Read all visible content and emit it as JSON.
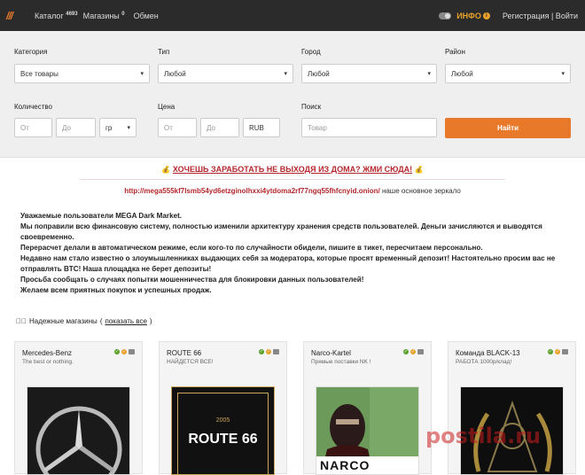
{
  "topbar": {
    "logo": "///",
    "catalog_label": "Каталог",
    "catalog_count": "4693",
    "shops_label": "Магазины",
    "shops_count": "0",
    "exchange_label": "Обмен",
    "info_label": "ИНФО",
    "auth_label": "Регистрация | Войти"
  },
  "filters": {
    "category_label": "Категория",
    "category_value": "Все товары",
    "type_label": "Тип",
    "type_value": "Любой",
    "city_label": "Город",
    "city_value": "Любой",
    "district_label": "Район",
    "district_value": "Любой",
    "quantity_label": "Количество",
    "qty_from_placeholder": "От",
    "qty_to_placeholder": "До",
    "qty_unit": "гр",
    "price_label": "Цена",
    "price_from_placeholder": "От",
    "price_to_placeholder": "До",
    "price_currency": "RUB",
    "search_label": "Поиск",
    "search_placeholder": "Товар",
    "find_button": "Найти"
  },
  "promo": {
    "text": "ХОЧЕШЬ ЗАРАБОТАТЬ НЕ ВЫХОДЯ ИЗ ДОМА? ЖМИ СЮДА!",
    "mirror_url": "http://mega555kf7lsmb54yd6etzginolhxxi4ytdoma2rf77ngq55fhfcnyid.onion/",
    "mirror_note": "наше основное зеркало"
  },
  "notice": {
    "lines": [
      "Уважаемые пользователи MEGA Dark Market.",
      "Мы поправили всю финансовую систему, полностью изменили архитектуру хранения средств пользователей. Деньги зачисляются и выводятся своевременно.",
      "Перерасчет делали в автоматическом режиме, если кого-то по случайности обидели, пишите в тикет, пересчитаем персонально.",
      "Недавно нам стало известно о злоумышленниках выдающих себя за модератора, которые просят временный депозит! Настоятельно просим вас не отправлять BTC! Наша площадка не берет депозиты!",
      "Просьба сообщать о случаях попытки мошенничества для блокировки данных пользователей!",
      "Желаем всем приятных покупок и успешных продаж."
    ]
  },
  "trusted": {
    "label": "Надежные магазины",
    "link": "показать все"
  },
  "shops": [
    {
      "name": "Mercedes-Benz",
      "tagline": "The best or nothing."
    },
    {
      "name": "ROUTE 66",
      "tagline": "НАЙДЕТСЯ ВСЕ!",
      "logo_year": "2005",
      "logo_text": "ROUTE 66"
    },
    {
      "name": "Narco-Kartel",
      "tagline": "Прямые поставки NK !",
      "logo_text": "NARCO"
    },
    {
      "name": "Команда BLACK-13",
      "tagline": "РАБОТА 1000р/клад!"
    }
  ],
  "watermark": "postila.ru",
  "colors": {
    "accent": "#e8792a",
    "topbar": "#2b2b2b",
    "promo": "#b5282d"
  }
}
